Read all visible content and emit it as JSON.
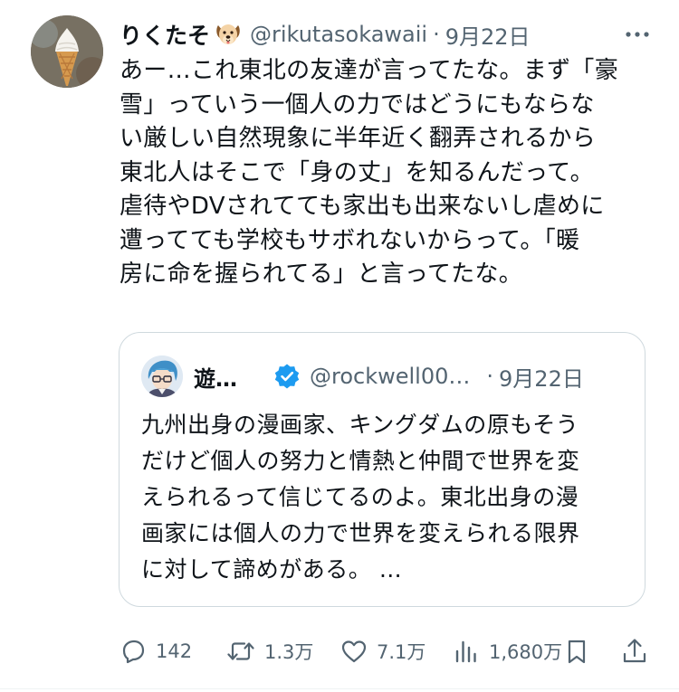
{
  "tweet": {
    "author": {
      "display_name": "りくたそ",
      "name_emoji": "dog-face-emoji",
      "handle": "@rikutasokawaii",
      "avatar": "soft-serve-ice-cream-avatar"
    },
    "separator": "·",
    "date": "9月22日",
    "more_icon": "more-horizontal-icon",
    "text_lines": [
      "あー…これ東北の友達が言ってたな。まず「豪",
      "雪」っていう一個人の力ではどうにもならな",
      "い厳しい自然現象に半年近く翻弄されるから",
      "東北人はそこで「身の丈」を知るんだって。",
      "虐待やDVされてても家出も出来ないし虐めに",
      "遭ってても学校もサボれないからって。「暖",
      "房に命を握られてる」と言ってたな。"
    ]
  },
  "quote": {
    "author": {
      "display_name": "遊…",
      "handle": "@rockwell00…",
      "avatar": "anime-character-avatar",
      "verified_icon": "verified-badge-icon"
    },
    "separator": "·",
    "date": "9月22日",
    "text_lines": [
      "九州出身の漫画家、キングダムの原もそう",
      "だけど個人の努力と情熱と仲間で世界を変",
      "えられるって信じてるのよ。東北出身の漫",
      "画家には個人の力で世界を変えられる限界",
      "に対して諦めがある。 …"
    ]
  },
  "actions": {
    "reply": {
      "icon": "reply-icon",
      "count": "142"
    },
    "repost": {
      "icon": "repost-icon",
      "count": "1.3万"
    },
    "like": {
      "icon": "heart-icon",
      "count": "7.1万"
    },
    "views": {
      "icon": "views-icon",
      "count": "1,680万"
    },
    "bookmark": {
      "icon": "bookmark-icon"
    },
    "share": {
      "icon": "share-icon"
    }
  },
  "colors": {
    "text": "#0f1419",
    "secondary": "#536471",
    "border": "#cfd9de",
    "verified": "#1d9bf0"
  }
}
